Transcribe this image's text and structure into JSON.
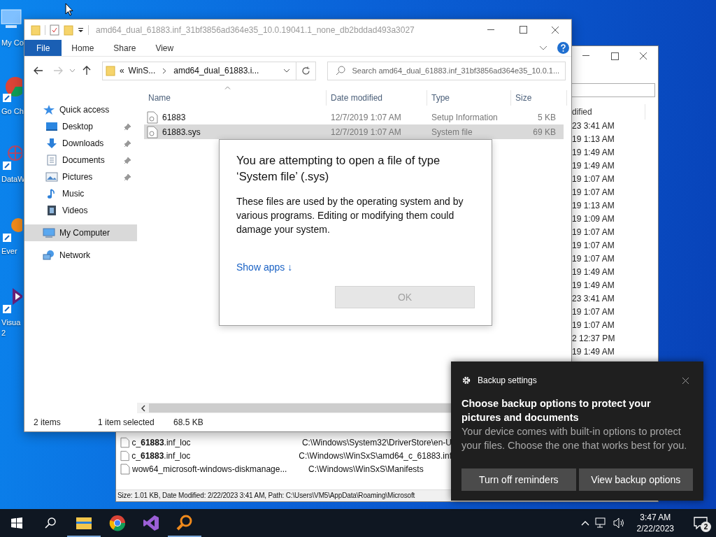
{
  "desktop_icons": [
    {
      "label": "My Co",
      "kind": "computer"
    },
    {
      "label": "Go Ch",
      "kind": "browser"
    },
    {
      "label": "DataW",
      "kind": "data"
    },
    {
      "label": "Ever",
      "kind": "finder"
    },
    {
      "label": "Visua 2",
      "kind": "studio"
    }
  ],
  "background_window": {
    "column_header": "dified",
    "dates": [
      "23 3:41 AM",
      "19 1:13 AM",
      "19 1:49 AM",
      "19 1:49 AM",
      "19 1:07 AM",
      "19 1:07 AM",
      "19 1:13 AM",
      "19 1:09 AM",
      "19 1:07 AM",
      "19 1:07 AM",
      "19 1:07 AM",
      "19 1:49 AM",
      "19 1:49 AM",
      "23 3:41 AM",
      "19 1:07 AM",
      "19 1:07 AM",
      "2 12:37 PM",
      "19 1:49 AM"
    ],
    "rows": [
      {
        "name": "c_**61883**.inf_loc",
        "path": "C:\\Windows\\System32\\DriverStore\\en-U"
      },
      {
        "name": "c_**61883**.inf_loc",
        "path": "C:\\Windows\\WinSxS\\amd64_c_61883.inf"
      },
      {
        "name": "wow64_microsoft-windows-diskmanage...",
        "path": "C:\\Windows\\WinSxS\\Manifests"
      }
    ],
    "status": "Size: 1.01 KB, Date Modified: 2/22/2023 3:41 AM, Path: C:\\Users\\VM5\\AppData\\Roaming\\Microsoft"
  },
  "explorer": {
    "title": "amd64_dual_61883.inf_31bf3856ad364e35_10.0.19041.1_none_db2bddad493a3027",
    "ribbon_tabs": [
      {
        "label": "File",
        "kind": "file"
      },
      {
        "label": "Home",
        "kind": "tab"
      },
      {
        "label": "Share",
        "kind": "tab"
      },
      {
        "label": "View",
        "kind": "tab"
      }
    ],
    "address": {
      "prefix": "«",
      "crumbs": [
        "WinS...",
        "amd64_dual_61883.i..."
      ]
    },
    "search": {
      "placeholder": "Search amd64_dual_61883.inf_31bf3856ad364e35_10.0.1..."
    },
    "nav": [
      {
        "label": "Quick access",
        "selected": false,
        "children": [
          {
            "label": "Desktop",
            "pinned": true,
            "selected": false
          },
          {
            "label": "Downloads",
            "pinned": true,
            "selected": false
          },
          {
            "label": "Documents",
            "pinned": true,
            "selected": false
          },
          {
            "label": "Pictures",
            "pinned": true,
            "selected": false
          },
          {
            "label": "Music",
            "pinned": false,
            "selected": false
          },
          {
            "label": "Videos",
            "pinned": false,
            "selected": false
          }
        ]
      },
      {
        "label": "My Computer",
        "selected": true
      },
      {
        "label": "Network",
        "selected": false
      }
    ],
    "columns": [
      "Name",
      "Date modified",
      "Type",
      "Size"
    ],
    "files": [
      {
        "name": "61883",
        "date": "12/7/2019 1:07 AM",
        "type": "Setup Information",
        "size": "5 KB",
        "selected": false
      },
      {
        "name": "61883.sys",
        "date": "12/7/2019 1:07 AM",
        "type": "System file",
        "size": "69 KB",
        "selected": true
      }
    ],
    "status": {
      "items": "2 items",
      "selection": "1 item selected",
      "size": "68.5 KB"
    }
  },
  "dialog": {
    "title": "You are attempting to open a file of type ‘System file’ (.sys)",
    "body": "These files are used by the operating system and by various programs. Editing or modifying them could damage your system.",
    "link": "Show apps ↓",
    "button": {
      "label": "OK",
      "disabled": true
    }
  },
  "toast": {
    "app": "Backup settings",
    "title": "Choose backup options to protect your pictures and documents",
    "body": "Your device comes with built-in options to protect your files. Choose the one that works best for you.",
    "buttons": [
      "Turn off reminders",
      "View backup options"
    ]
  },
  "taskbar": {
    "apps": [
      {
        "kind": "explorer",
        "running": true
      },
      {
        "kind": "browser",
        "running": false
      },
      {
        "kind": "studio",
        "running": false
      },
      {
        "kind": "finder",
        "running": true
      }
    ],
    "time": "3:47 AM",
    "date": "2/22/2023",
    "notifications": "2"
  }
}
